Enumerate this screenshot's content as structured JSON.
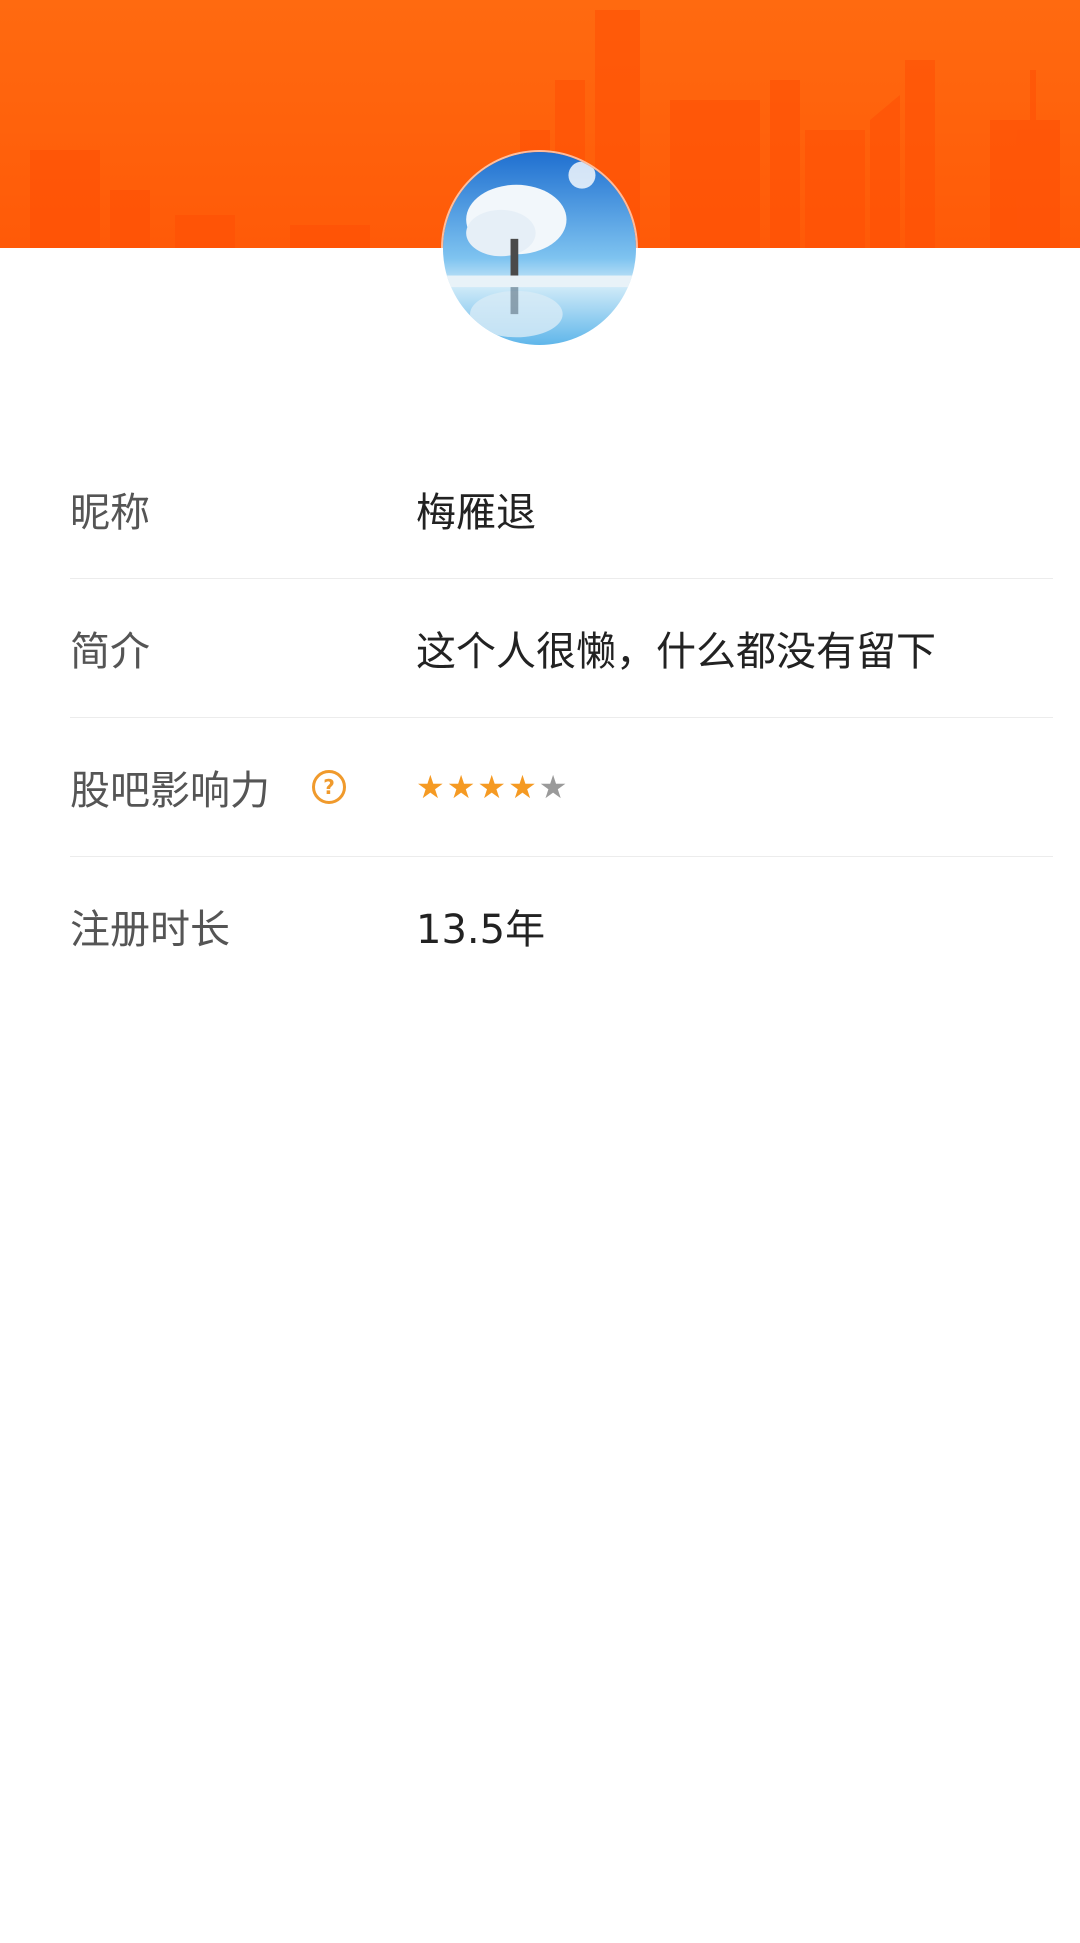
{
  "profile": {
    "rows": [
      {
        "label": "昵称",
        "value": "梅雁退"
      },
      {
        "label": "简介",
        "value": "这个人很懒，什么都没有留下"
      },
      {
        "label": "股吧影响力",
        "rating": 4,
        "rating_max": 5
      },
      {
        "label": "注册时长",
        "value": "13.5年"
      }
    ]
  },
  "colors": {
    "header": "#ff6010",
    "star_filled": "#f59a23",
    "star_empty": "#9a9a9a",
    "help_icon": "#f09a2c"
  },
  "icons": {
    "help": "question-circle-icon",
    "star": "star-icon"
  },
  "glyphs": {
    "help": "?",
    "star": "★"
  }
}
